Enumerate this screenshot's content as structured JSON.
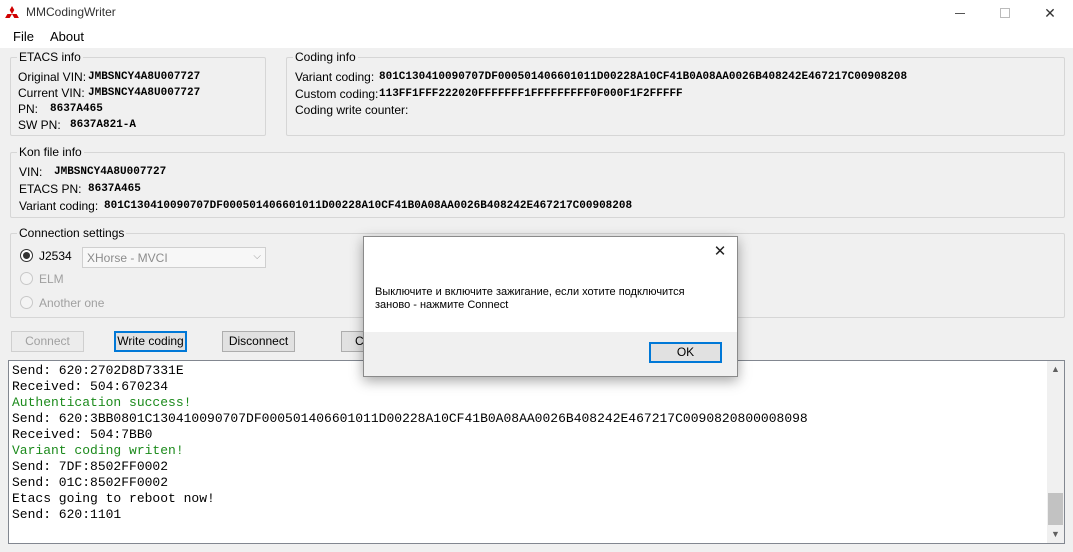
{
  "window": {
    "title": "MMCodingWriter",
    "minimize": "—",
    "close": "✕"
  },
  "menu": [
    "File",
    "About"
  ],
  "etacs": {
    "title": "ETACS info",
    "original_vin_label": "Original VIN:",
    "original_vin": "JMBSNCY4A8U007727",
    "current_vin_label": "Current VIN:",
    "current_vin": "JMBSNCY4A8U007727",
    "pn_label": "PN:",
    "pn": "8637A465",
    "swpn_label": "SW PN:",
    "swpn": "8637A821-A"
  },
  "coding": {
    "title": "Coding info",
    "variant_label": "Variant coding:",
    "variant": "801C130410090707DF000501406601011D00228A10CF41B0A08AA0026B408242E467217C00908208",
    "custom_label": "Custom coding:",
    "custom": "113FF1FFF222020FFFFFFF1FFFFFFFFF0F000F1F2FFFFF",
    "counter_label": "Coding write counter:"
  },
  "kon": {
    "title": "Kon file info",
    "vin_label": "VIN:",
    "vin": "JMBSNCY4A8U007727",
    "etacs_pn_label": "ETACS PN:",
    "etacs_pn": "8637A465",
    "variant_label": "Variant coding:",
    "variant": "801C130410090707DF000501406601011D00228A10CF41B0A08AA0026B408242E467217C00908208"
  },
  "connection": {
    "title": "Connection settings",
    "j2534": "J2534",
    "elm": "ELM",
    "another": "Another one",
    "device": "XHorse - MVCI"
  },
  "buttons": {
    "connect": "Connect",
    "write": "Write coding",
    "disconnect": "Disconnect",
    "partial": "C"
  },
  "log": [
    {
      "text": "Send: 620:2702D8D7331E",
      "ok": false
    },
    {
      "text": "Received: 504:670234",
      "ok": false
    },
    {
      "text": "Authentication success!",
      "ok": true
    },
    {
      "text": "Send: 620:3BB0801C130410090707DF000501406601011D00228A10CF41B0A08AA0026B408242E467217C0090820800008098",
      "ok": false
    },
    {
      "text": "Received: 504:7BB0",
      "ok": false
    },
    {
      "text": "Variant coding writen!",
      "ok": true
    },
    {
      "text": "Send: 7DF:8502FF0002",
      "ok": false
    },
    {
      "text": "Send: 01C:8502FF0002",
      "ok": false
    },
    {
      "text": "Etacs going to reboot now!",
      "ok": false
    },
    {
      "text": "Send: 620:1101",
      "ok": false
    }
  ],
  "dialog": {
    "close": "✕",
    "message": "Выключите и включите зажигание, если хотите подключится заново - нажмите Connect",
    "ok": "OK"
  },
  "colors": {
    "success_text": "#1b8a1b",
    "accent": "#0078d7"
  }
}
